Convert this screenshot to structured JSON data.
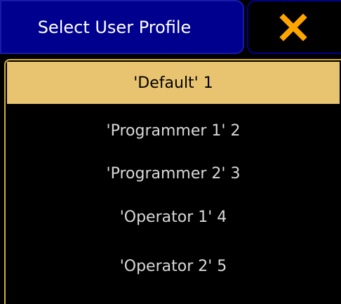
{
  "dialog": {
    "title": "Select User Profile",
    "close_icon": "close-x-icon",
    "close_color": "#ffa500"
  },
  "colors": {
    "title_background": "#00008f",
    "selection_background": "#e8c471",
    "panel_border": "#d4af37",
    "item_text": "#d9d9d9"
  },
  "profiles": [
    {
      "label": "'Default' 1",
      "selected": true
    },
    {
      "label": "'Programmer 1' 2",
      "selected": false
    },
    {
      "label": "'Programmer 2' 3",
      "selected": false
    },
    {
      "label": "'Operator 1' 4",
      "selected": false
    },
    {
      "label": "'Operator 2' 5",
      "selected": false
    }
  ]
}
